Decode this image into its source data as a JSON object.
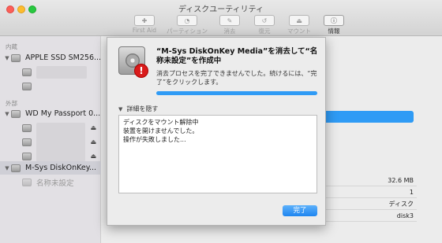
{
  "window": {
    "title": "ディスクユーティリティ"
  },
  "toolbar": {
    "items": [
      {
        "label": "First Aid",
        "icon": "stethoscope-icon",
        "glyph": "✚"
      },
      {
        "label": "パーティション",
        "icon": "partition-icon",
        "glyph": "◔"
      },
      {
        "label": "消去",
        "icon": "erase-icon",
        "glyph": "✎"
      },
      {
        "label": "復元",
        "icon": "restore-icon",
        "glyph": "↺"
      },
      {
        "label": "マウント",
        "icon": "mount-icon",
        "glyph": "⏏"
      },
      {
        "label": "情報",
        "icon": "info-icon",
        "glyph": "ⓘ"
      }
    ]
  },
  "sidebar": {
    "internal_header": "内蔵",
    "external_header": "外部",
    "internal_disk": "APPLE SSD SM256...",
    "external_disk": "WD My Passport 0...",
    "selected_disk": "M-Sys DiskOnKey...",
    "selected_volume": "名称未設定"
  },
  "dialog": {
    "title": "“M-Sys DiskOnKey Media”を消去して“名称未設定”を作成中",
    "body": "消去プロセスを完了できませんでした。続けるには、“完了”をクリックします。",
    "progress": 1.0,
    "details_toggle": "詳細を隠す",
    "log": [
      "ディスクをマウント解除中",
      "装置を開けませんでした。",
      "操作が失敗しました..."
    ],
    "done_button": "完了"
  },
  "info": {
    "capacity": "32.6 MB",
    "count": "1",
    "type": "ディスク",
    "device": "disk3"
  },
  "colors": {
    "accent": "#2f9bf5",
    "alert": "#d91b1b"
  }
}
